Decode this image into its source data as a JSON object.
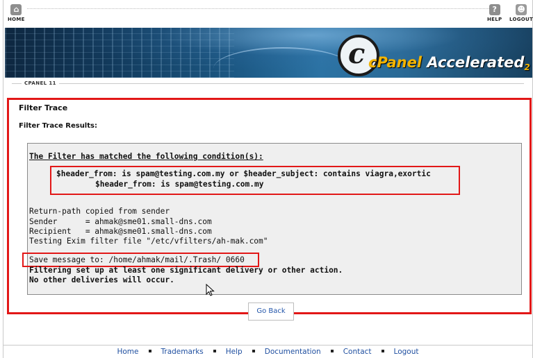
{
  "topbar": {
    "home_label": "HOME",
    "help_label": "HELP",
    "logout_label": "LOGOUT"
  },
  "banner": {
    "brand_c": "c",
    "brand_cp": "cPanel",
    "brand_rest": " Accelerated",
    "brand_version": "2"
  },
  "breadcrumb": {
    "label": "CPANEL 11"
  },
  "page": {
    "title": "Filter Trace",
    "results_title": "Filter Trace Results:"
  },
  "trace": {
    "matched_heading": "The Filter has matched the following condition(s):",
    "condition_line1": "$header_from: is spam@testing.com.my or $header_subject: contains viagra,exortic",
    "condition_line2": "$header_from: is spam@testing.com.my",
    "returnpath": "Return-path copied from sender",
    "sender": "Sender      = ahmak@sme01.small-dns.com",
    "recipient": "Recipient   = ahmak@sme01.small-dns.com",
    "testing": "Testing Exim filter file \"/etc/vfilters/ah-mak.com\"",
    "save_message": "Save message to: /home/ahmak/mail/.Trash/ 0660",
    "filtering": "Filtering set up at least one significant delivery or other action.",
    "no_other": "No other deliveries will occur."
  },
  "go_back_label": "Go Back",
  "footer": {
    "links": [
      "Home",
      "Trademarks",
      "Help",
      "Documentation",
      "Contact",
      "Logout"
    ]
  },
  "colors": {
    "highlight": "#e21717",
    "link": "#1f4fa0"
  }
}
